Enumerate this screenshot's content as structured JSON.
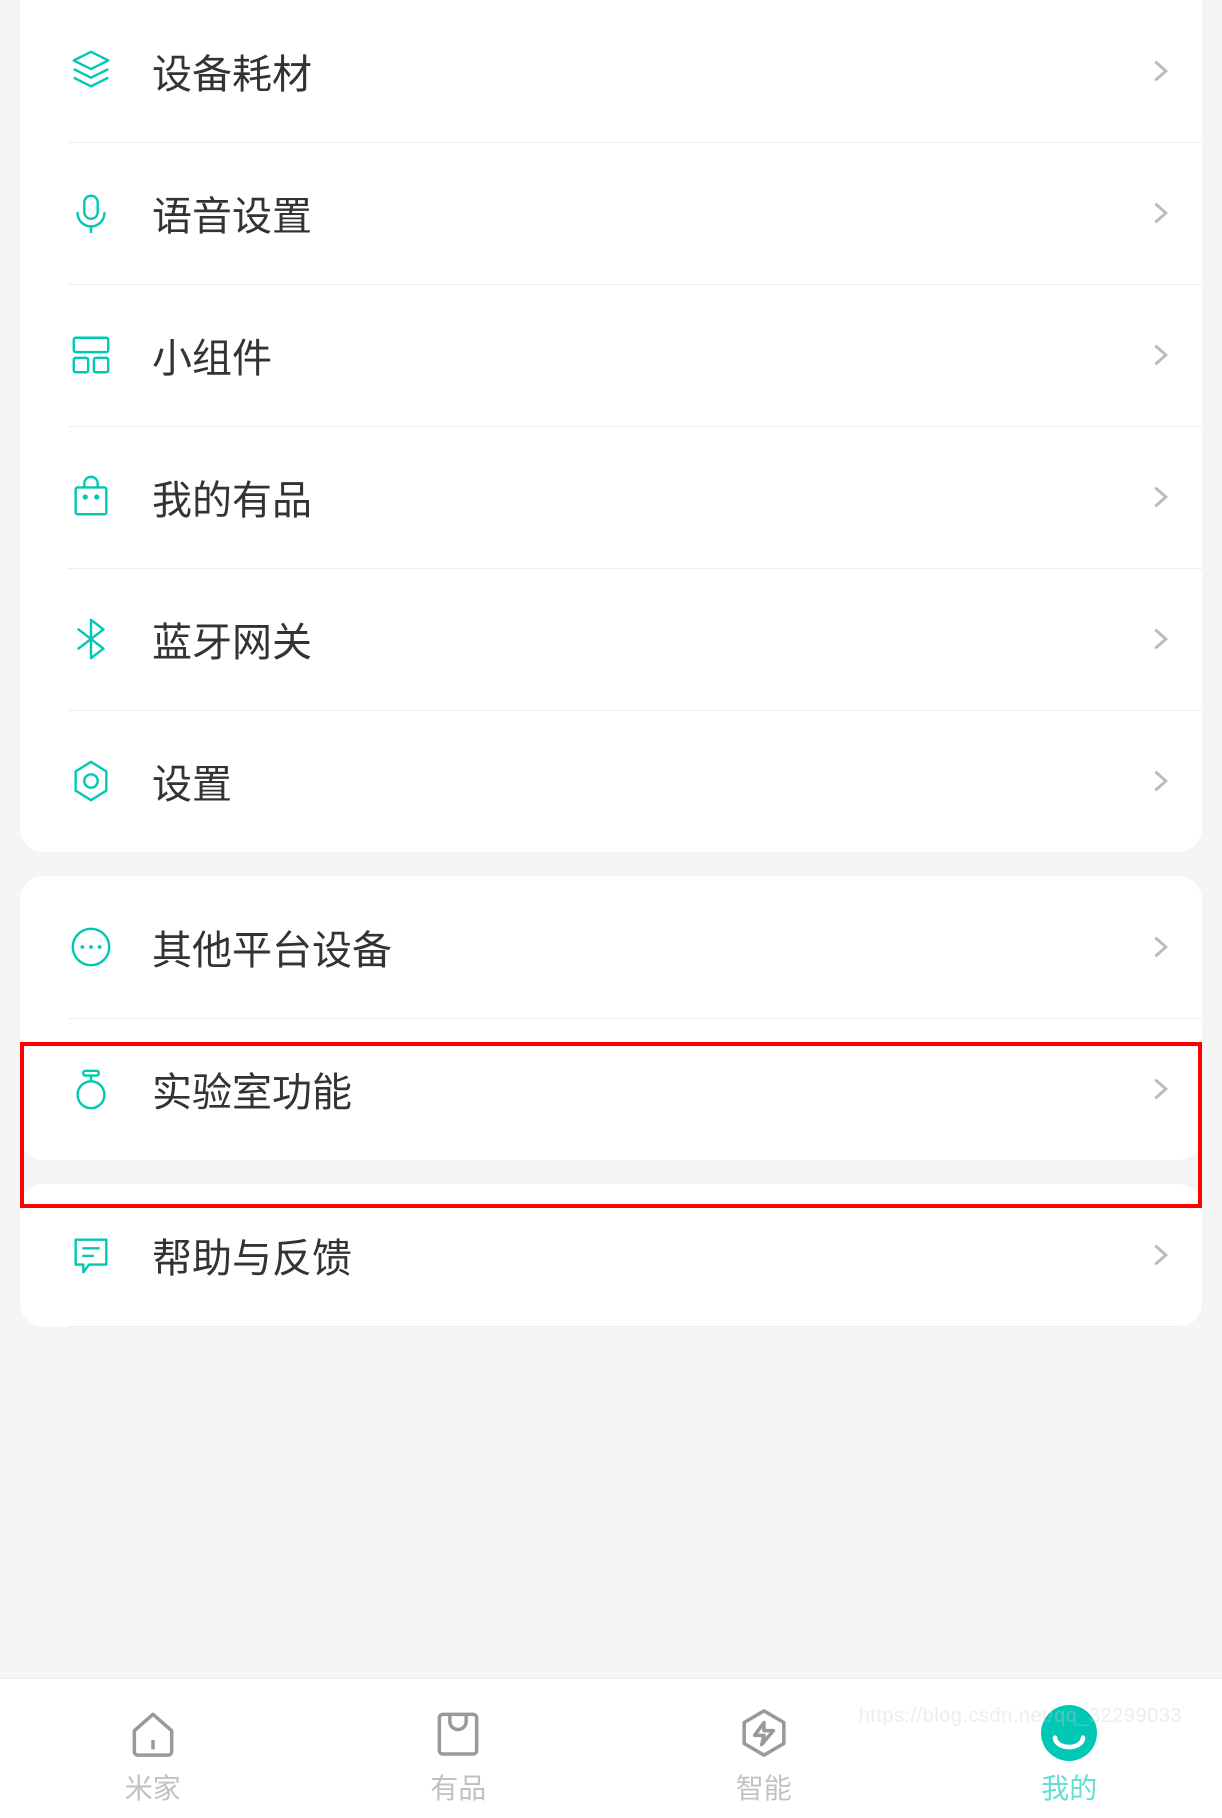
{
  "accent": "#00c8b4",
  "groups": [
    {
      "items": [
        {
          "id": "consumables",
          "label": "设备耗材",
          "icon": "layers-icon"
        },
        {
          "id": "voice",
          "label": "语音设置",
          "icon": "mic-icon"
        },
        {
          "id": "widgets",
          "label": "小组件",
          "icon": "widgets-icon"
        },
        {
          "id": "youpin",
          "label": "我的有品",
          "icon": "bag-icon"
        },
        {
          "id": "bluetooth",
          "label": "蓝牙网关",
          "icon": "bluetooth-icon"
        },
        {
          "id": "settings",
          "label": "设置",
          "icon": "gear-icon"
        }
      ]
    },
    {
      "items": [
        {
          "id": "other-platform",
          "label": "其他平台设备",
          "icon": "dots-circle-icon",
          "highlighted": true
        },
        {
          "id": "lab",
          "label": "实验室功能",
          "icon": "flask-icon"
        }
      ]
    },
    {
      "items": [
        {
          "id": "help",
          "label": "帮助与反馈",
          "icon": "chat-icon"
        }
      ]
    }
  ],
  "tabs": [
    {
      "id": "home",
      "label": "米家",
      "icon": "home-icon",
      "active": false
    },
    {
      "id": "shop",
      "label": "有品",
      "icon": "shop-icon",
      "active": false
    },
    {
      "id": "smart",
      "label": "智能",
      "icon": "smart-icon",
      "active": false
    },
    {
      "id": "mine",
      "label": "我的",
      "icon": "mine-icon",
      "active": true
    }
  ],
  "watermark": "https://blog.csdn.net/qq_32299033"
}
